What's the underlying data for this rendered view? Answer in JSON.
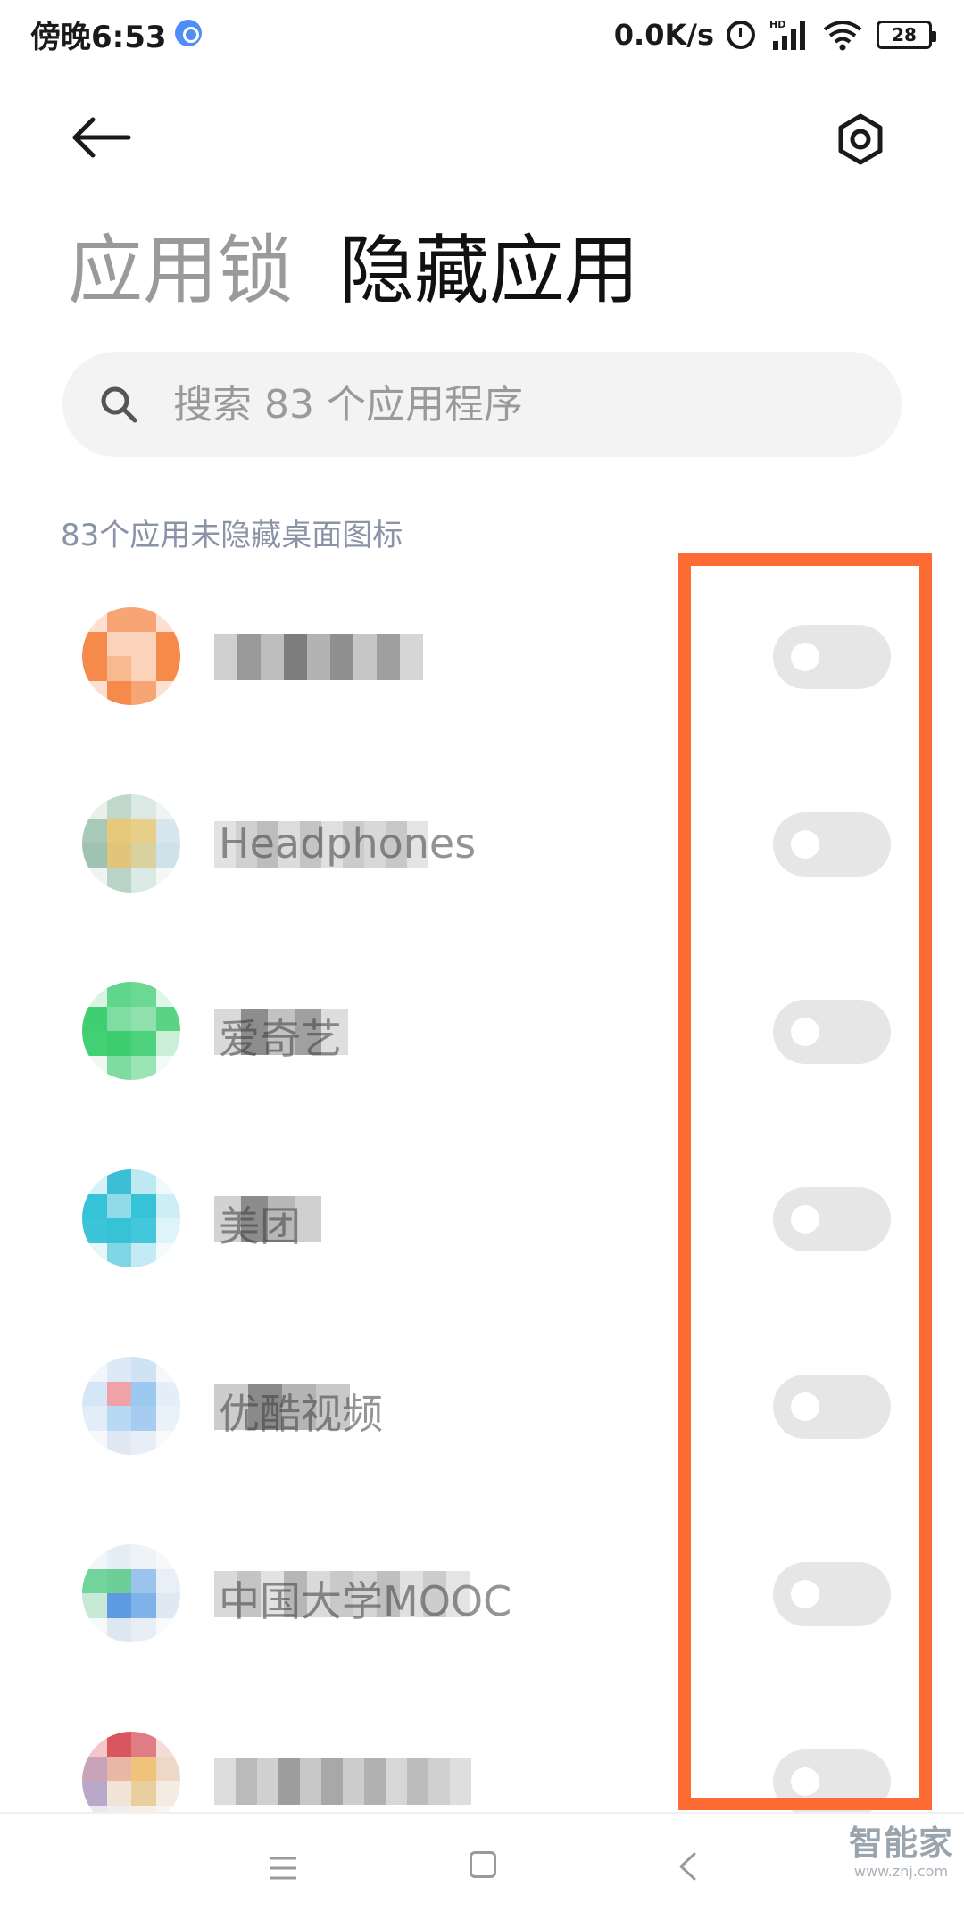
{
  "status_bar": {
    "time": "傍晚6:53",
    "net_speed": "0.0K/s",
    "signal_label": "HD",
    "battery": "28"
  },
  "tabs": [
    {
      "label": "应用锁",
      "active": false
    },
    {
      "label": "隐藏应用",
      "active": true
    }
  ],
  "search": {
    "placeholder": "搜索 83 个应用程序"
  },
  "section_header": "83个应用未隐藏桌面图标",
  "apps": [
    {
      "name": "",
      "icon_color": "#f58a4b",
      "hidden": false
    },
    {
      "name": "Headphones",
      "icon_color": "#e6c97a",
      "hidden": false
    },
    {
      "name": "爱奇艺",
      "icon_color": "#2ecc71",
      "hidden": false
    },
    {
      "name": "美团",
      "icon_color": "#36c3d8",
      "hidden": false
    },
    {
      "name": "优酷视频",
      "icon_color": "#9cc9f0",
      "hidden": false
    },
    {
      "name": "中国大学MOOC",
      "icon_color": "#7fb2e8",
      "hidden": false
    },
    {
      "name": "",
      "icon_color": "#d9555f",
      "hidden": false
    }
  ],
  "colors": {
    "highlight": "#ff6b35",
    "toggle_off": "#e6e6e6",
    "tab_inactive": "#9a9a9a",
    "section_header": "#8a94a6"
  },
  "watermark": {
    "main": "智能家",
    "sub": "www.znj.com"
  }
}
